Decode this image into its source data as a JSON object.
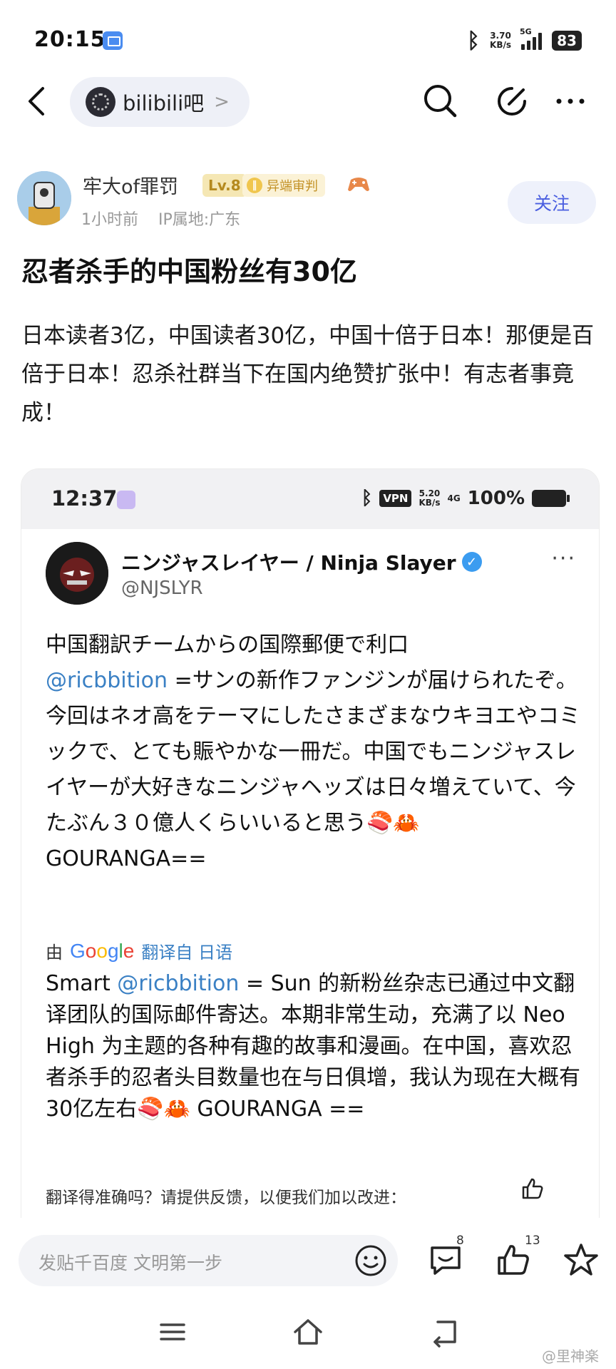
{
  "status_bar": {
    "time": "20:15",
    "net_speed_value": "3.70",
    "net_speed_unit": "KB/s",
    "network": "5G",
    "battery": "83"
  },
  "nav": {
    "forum_name": "bilibili吧",
    "chevron": ">"
  },
  "post": {
    "author": "牢大of罪罚",
    "level": "Lv.8",
    "title_badge": "异端审判",
    "time_ago": "1小时前",
    "ip_location": "IP属地:广东",
    "follow_label": "关注",
    "title": "忍者杀手的中国粉丝有30亿",
    "body": "日本读者3亿，中国读者30亿，中国十倍于日本！那便是百倍于日本！忍杀社群当下在国内绝赞扩张中！有志者事竟成！"
  },
  "embedded": {
    "status_bar": {
      "time": "12:37",
      "vpn": "VPN",
      "speed_value": "5.20",
      "speed_unit": "KB/s",
      "network": "4G",
      "battery_pct": "100%"
    },
    "tweet": {
      "display_name": "ニンジャスレイヤー / Ninja Slayer",
      "handle": "@NJSLYR",
      "text_part1": "中国翻訳チームからの国際郵便で利口",
      "mention": "@ricbbition",
      "text_part2": " =サンの新作ファンジンが届けられたぞ。今回はネオ高をテーマにしたさまざまなウキヨエやコミックで、とても賑やかな一冊だ。中国でもニンジャスレイヤーが大好きなニンジャヘッズは日々増えていて、今たぶん３０億人くらいいると思う🍣🦀",
      "text_part3": "GOURANGA==",
      "translated_by_prefix": "由",
      "google": [
        "G",
        "o",
        "o",
        "g",
        "l",
        "e"
      ],
      "translated_from": "翻译自 日语",
      "translation_part1": "Smart ",
      "translation_mention": "@ricbbition",
      "translation_part2": " = Sun 的新粉丝杂志已通过中文翻译团队的国际邮件寄达。本期非常生动，充满了以 Neo High 为主题的各种有趣的故事和漫画。在中国，喜欢忍者杀手的忍者头目数量也在与日俱增，我认为现在大概有30亿左右🍣🦀 GOURANGA ==",
      "feedback": "翻译得准确吗？请提供反馈，以便我们加以改进："
    }
  },
  "bottom_bar": {
    "comment_placeholder": "发贴千百度 文明第一步",
    "comment_count": "8",
    "like_count": "13"
  },
  "watermark": "@里神楽",
  "icons": [
    "back-arrow-icon",
    "search-icon",
    "edit-icon",
    "more-icon",
    "emoji-icon",
    "comment-icon",
    "like-icon",
    "star-icon",
    "menu-icon",
    "home-icon",
    "return-icon"
  ]
}
